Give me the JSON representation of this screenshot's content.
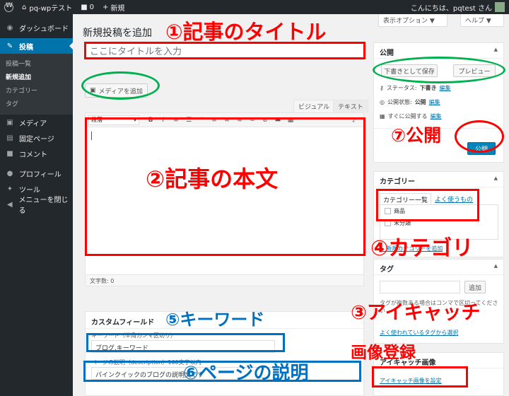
{
  "adminbar": {
    "site_name": "pq-wpテスト",
    "comments_count": "0",
    "new_label": "新規",
    "greeting": "こんにちは、pqtest さん"
  },
  "sidebar": {
    "dashboard": "ダッシュボード",
    "posts": "投稿",
    "posts_sub": [
      "投稿一覧",
      "新規追加",
      "カテゴリー",
      "タグ"
    ],
    "media": "メディア",
    "pages": "固定ページ",
    "comments": "コメント",
    "profile": "プロフィール",
    "tools": "ツール",
    "collapse": "メニューを閉じる"
  },
  "header": {
    "screen_options": "表示オプション ▼",
    "help": "ヘルプ ▼",
    "title": "新規投稿を追加"
  },
  "post": {
    "title_placeholder": "ここにタイトルを入力",
    "media_button": "メディアを追加",
    "tab_visual": "ビジュアル",
    "tab_text": "テキスト",
    "format": "段落",
    "word_count": "文字数: 0"
  },
  "custom_fields": {
    "title": "カスタムフィールド",
    "keyword_label": "キーワード（半角カンマ区切り）",
    "keyword_value": "ブログ,キーワード",
    "description_label": "ページの説明（description）160文字以内",
    "description_value": "パインクイックのブログの説明文です"
  },
  "publish": {
    "title": "公開",
    "save_draft": "下書きとして保存",
    "preview": "プレビュー",
    "status_label": "ステータス:",
    "status_value": "下書き",
    "status_edit": "編集",
    "visibility_label": "公開状態:",
    "visibility_value": "公開",
    "visibility_edit": "編集",
    "schedule_label": "すぐに公開する",
    "schedule_edit": "編集",
    "publish_button": "公開"
  },
  "categories": {
    "title": "カテゴリー",
    "tab_all": "カテゴリー一覧",
    "tab_popular": "よく使うもの",
    "items": [
      "商品",
      "未分類"
    ],
    "add_new": "+ 新規カテゴリーを追加"
  },
  "tags": {
    "title": "タグ",
    "add_button": "追加",
    "hint": "タグが複数ある場合はコンマで区切ってください",
    "popular_link": "よく使われているタグから選択"
  },
  "featured": {
    "title": "アイキャッチ画像",
    "set_link": "アイキャッチ画像を設定"
  },
  "annotations": {
    "title": "①記事のタイトル",
    "body": "②記事の本文",
    "eyecatch_line1": "③アイキャッチ",
    "eyecatch_line2": "画像登録",
    "category": "④カテゴリ",
    "keyword": "⑤キーワード",
    "description": "⑥ページの説明",
    "publish": "⑦公開"
  },
  "colors": {
    "annotation_red": "#ff0000",
    "annotation_green": "#00b050",
    "annotation_blue": "#0070c0",
    "wp_primary": "#0085ba",
    "sidebar_bg": "#23282d"
  }
}
